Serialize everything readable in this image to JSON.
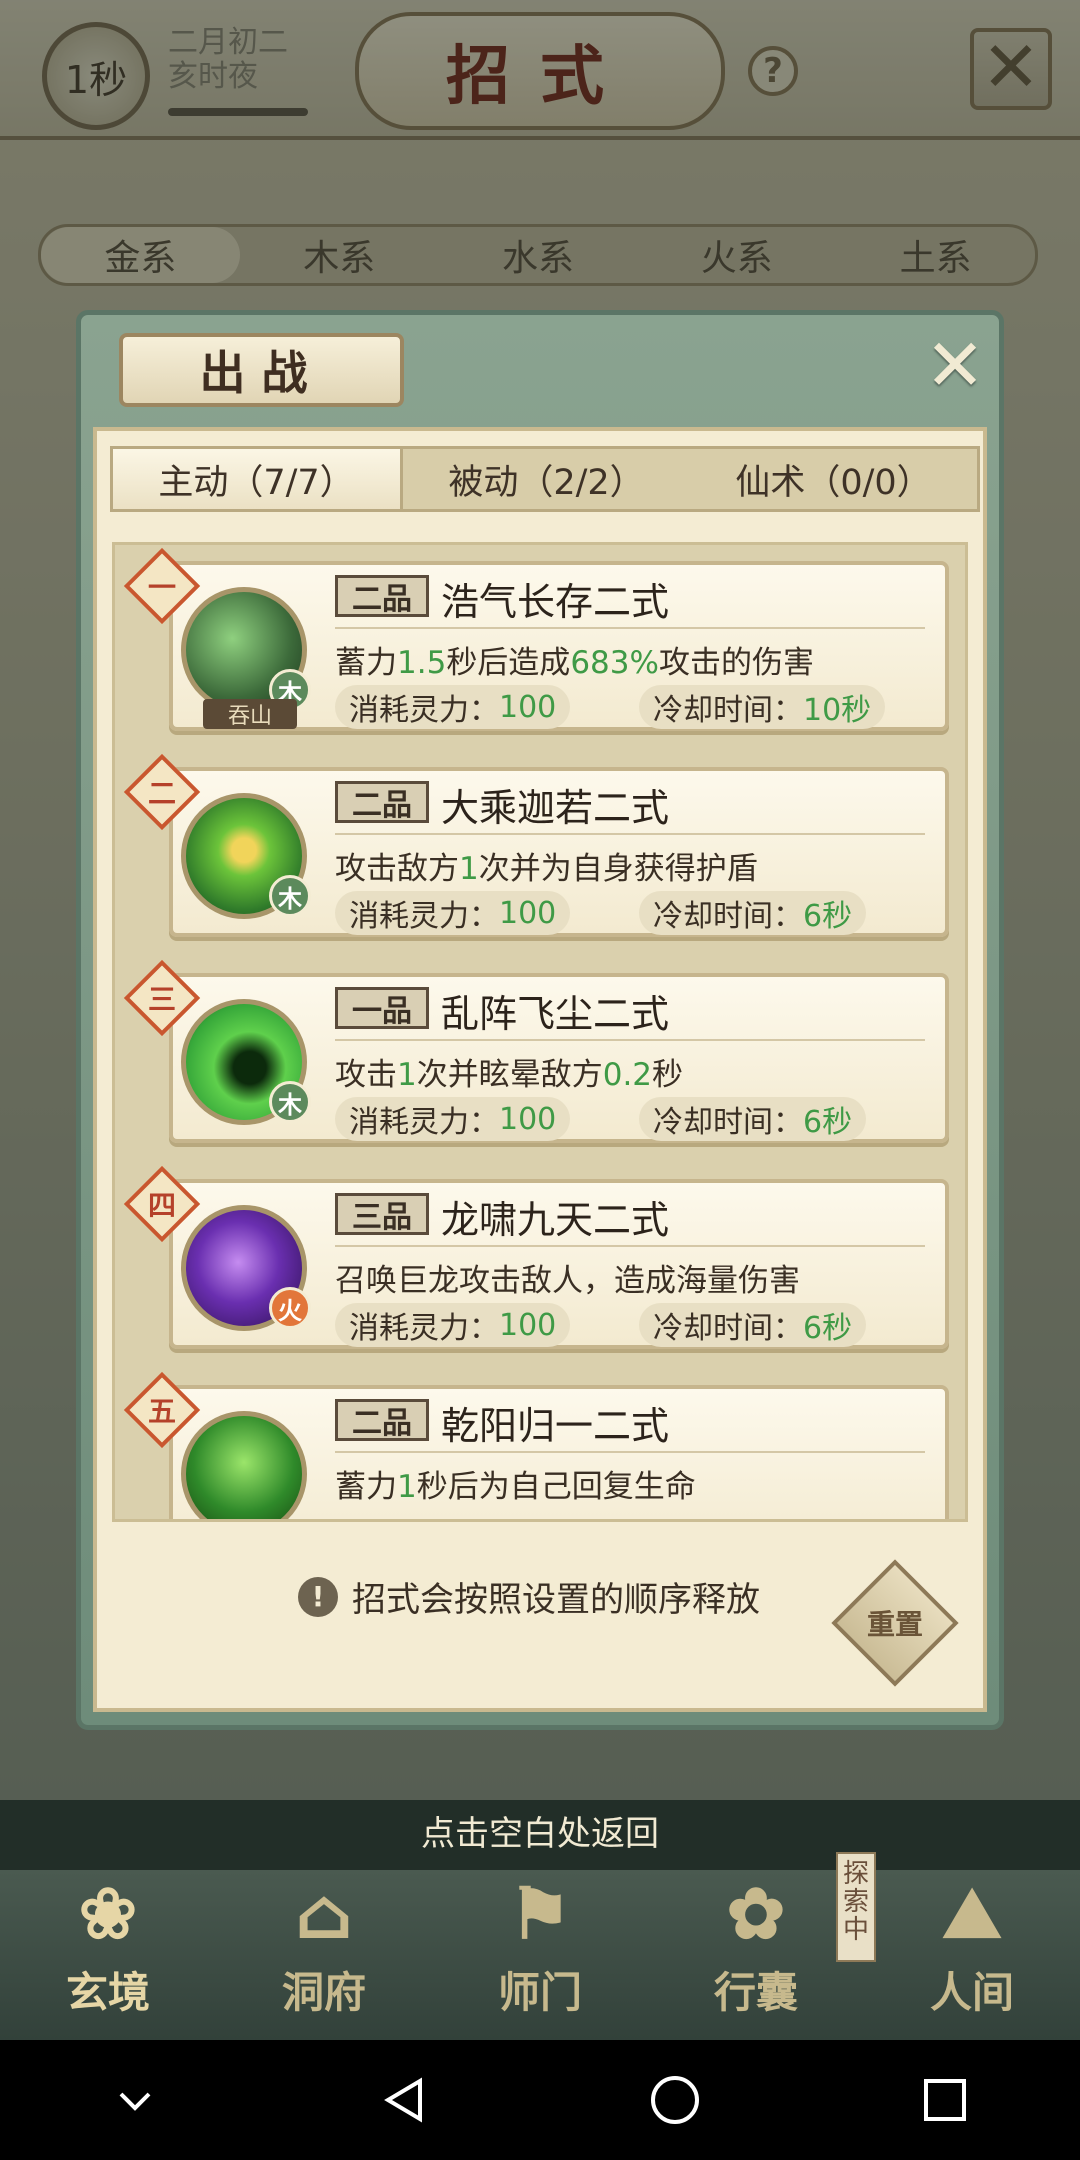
{
  "header": {
    "timer": "1秒",
    "date_line1": "二月初二",
    "date_line2": "亥时夜",
    "title": "招式",
    "help": "?"
  },
  "element_tabs": [
    "金系",
    "木系",
    "水系",
    "火系",
    "土系"
  ],
  "modal": {
    "title": "出战",
    "sub_tabs": [
      "主动（7/7）",
      "被动（2/2）",
      "仙术（0/0）"
    ],
    "skills": [
      {
        "order": "一",
        "grade": "二品",
        "name": "浩气长存二式",
        "element": "木",
        "tag": "吞山",
        "desc_parts": [
          "蓄力",
          "1.5",
          "秒后造成",
          "683%",
          "攻击的伤害"
        ],
        "cost_label": "消耗灵力：",
        "cost_value": "100",
        "cd_label": "冷却时间：",
        "cd_value": "10秒",
        "icon_color": "#3c6a3a"
      },
      {
        "order": "二",
        "grade": "二品",
        "name": "大乘迦若二式",
        "element": "木",
        "desc_parts": [
          "攻击敌方",
          "1",
          "次并为自身获得护盾"
        ],
        "cost_label": "消耗灵力：",
        "cost_value": "100",
        "cd_label": "冷却时间：",
        "cd_value": "6秒",
        "icon_color": "#2f7a2a"
      },
      {
        "order": "三",
        "grade": "一品",
        "name": "乱阵飞尘二式",
        "element": "木",
        "desc_parts": [
          "攻击",
          "1",
          "次并眩晕敌方",
          "0.2",
          "秒"
        ],
        "cost_label": "消耗灵力：",
        "cost_value": "100",
        "cd_label": "冷却时间：",
        "cd_value": "6秒",
        "icon_color": "#37a83a"
      },
      {
        "order": "四",
        "grade": "三品",
        "name": "龙啸九天二式",
        "element": "火",
        "desc_parts": [
          "召唤巨龙攻击敌人，造成海量伤害"
        ],
        "cost_label": "消耗灵力：",
        "cost_value": "100",
        "cd_label": "冷却时间：",
        "cd_value": "6秒",
        "icon_color": "#5a2a8c"
      },
      {
        "order": "五",
        "grade": "二品",
        "name": "乾阳归一二式",
        "element": "",
        "desc_parts": [
          "蓄力",
          "1",
          "秒后为自己回复生命"
        ],
        "icon_color": "#2f8a2a"
      }
    ],
    "hint": "招式会按照设置的顺序释放",
    "hint_icon": "!",
    "reset_label": "重置"
  },
  "return_hint": "点击空白处返回",
  "bottom_nav": [
    {
      "label": "玄境",
      "glyph": "❀"
    },
    {
      "label": "洞府",
      "glyph": "⌂"
    },
    {
      "label": "师门",
      "glyph": "⚑"
    },
    {
      "label": "行囊",
      "glyph": "✿"
    },
    {
      "label": "人间",
      "glyph": "⛰"
    }
  ],
  "explore_tag": "探索中",
  "colors": {
    "accent_green": "#3f9a46",
    "title_red": "#7a2a1c",
    "panel": "#f4ecd3"
  }
}
